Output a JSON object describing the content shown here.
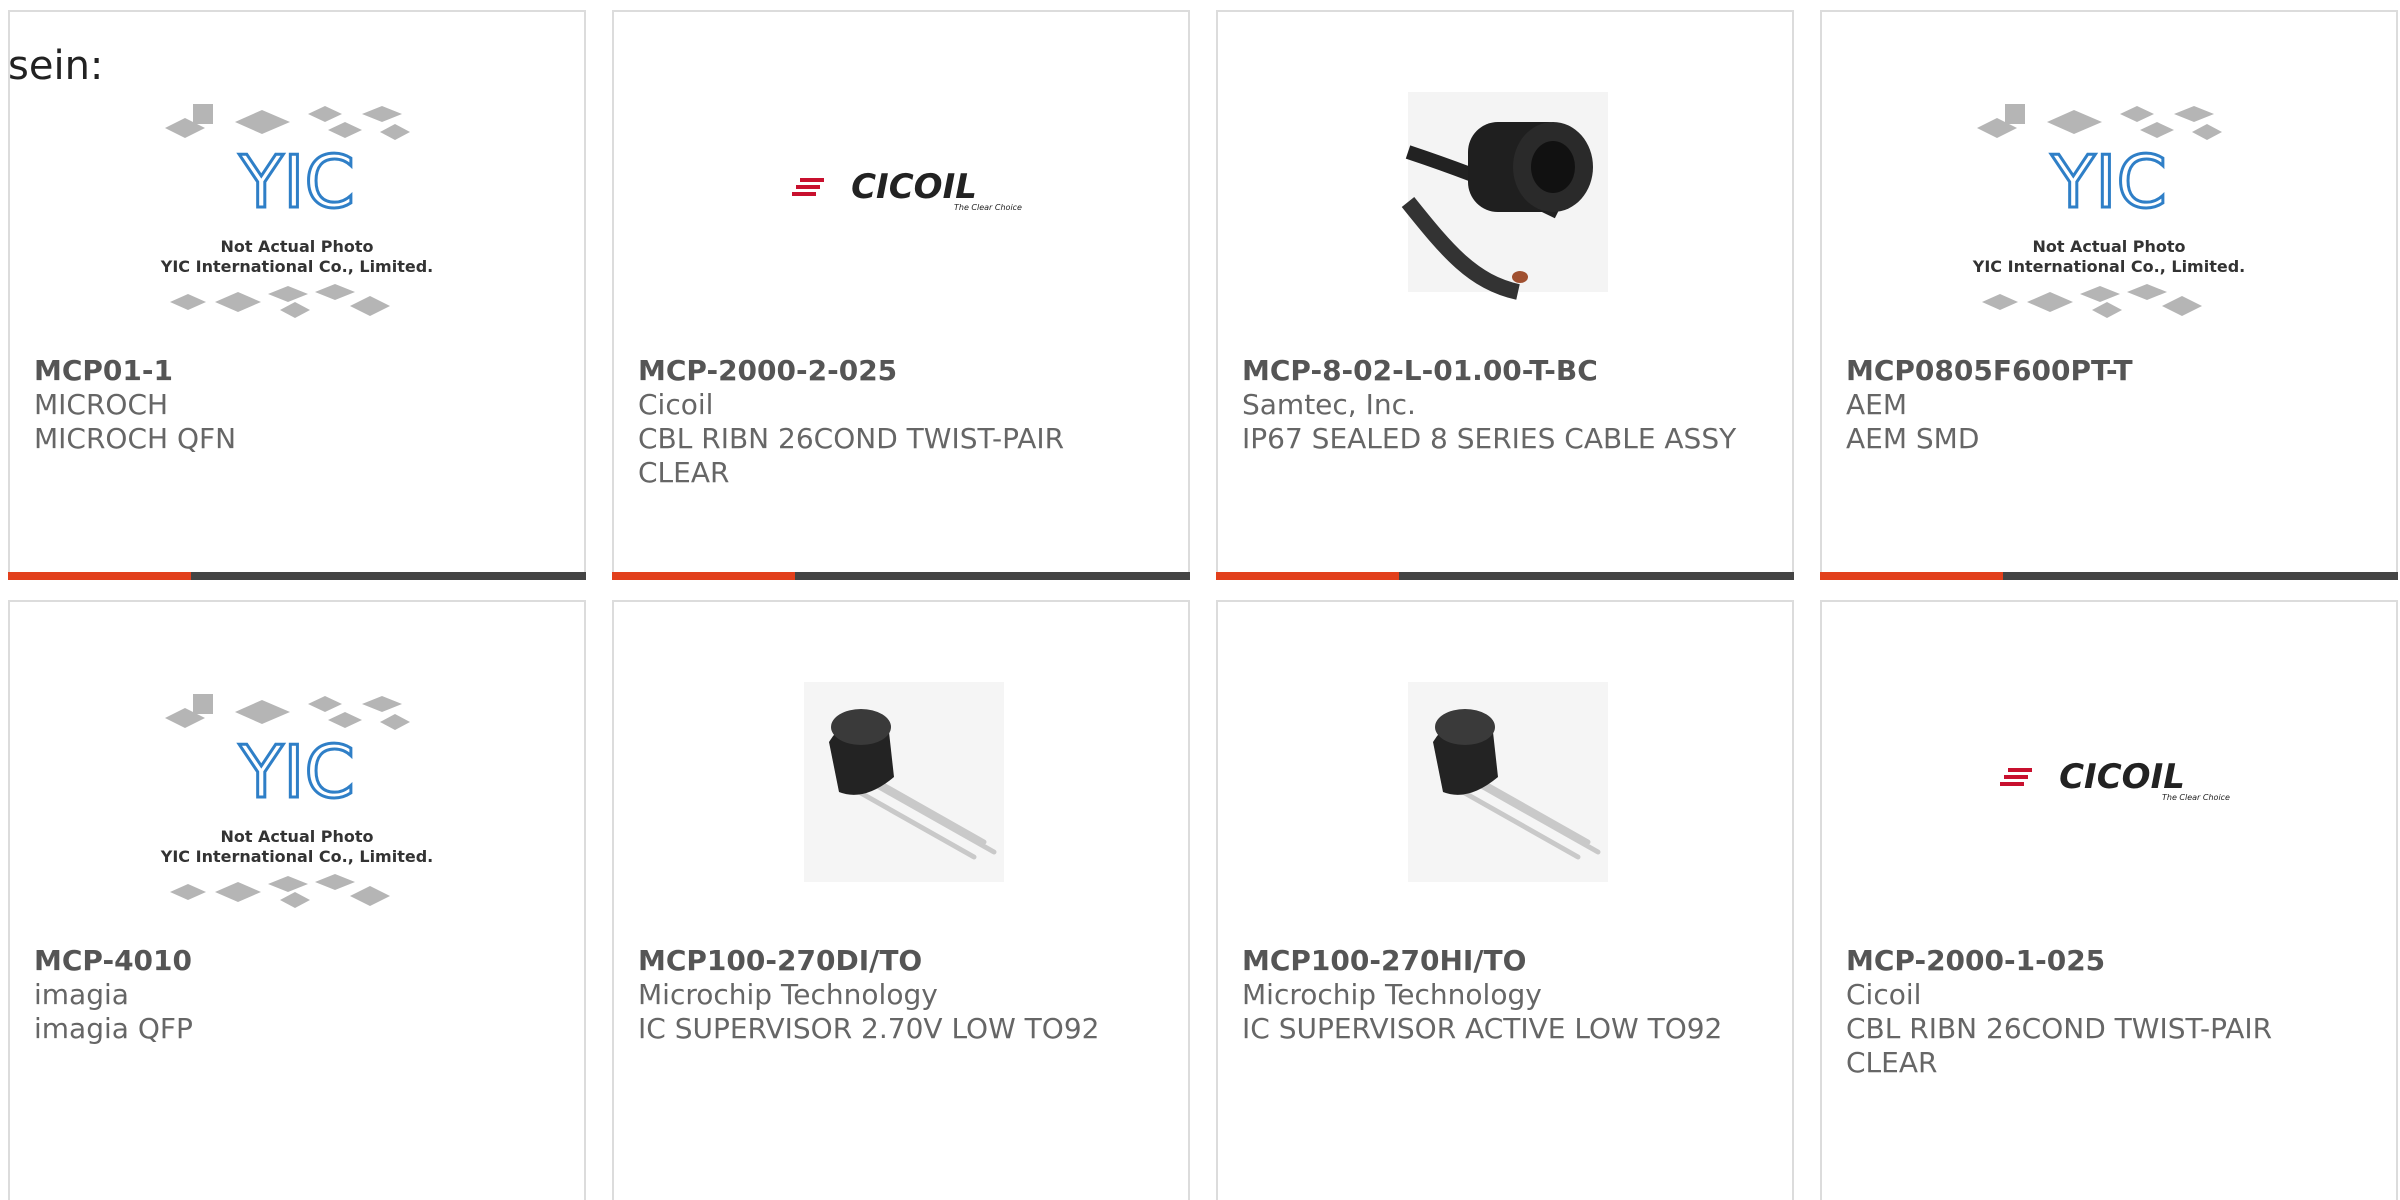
{
  "lead": "sein:",
  "products": [
    {
      "pn": "MCP01-1",
      "mfr": "MICROCH",
      "desc": "MICROCH QFN",
      "image": "yic-placeholder-icon",
      "yic_line1": "Not Actual Photo",
      "yic_line2": "YIC International Co., Limited."
    },
    {
      "pn": "MCP-2000-2-025",
      "mfr": "Cicoil",
      "desc": "CBL RIBN 26COND TWIST-PAIR CLEAR",
      "image": "cicoil-logo",
      "logo_text": "CICOIL",
      "logo_tag": "The Clear Choice"
    },
    {
      "pn": "MCP-8-02-L-01.00-T-BC",
      "mfr": "Samtec, Inc.",
      "desc": "IP67 SEALED 8 SERIES CABLE ASSY",
      "image": "cable-connector-photo"
    },
    {
      "pn": "MCP0805F600PT-T",
      "mfr": "AEM",
      "desc": "AEM SMD",
      "image": "yic-placeholder-icon",
      "yic_line1": "Not Actual Photo",
      "yic_line2": "YIC International Co., Limited."
    },
    {
      "pn": "MCP-4010",
      "mfr": "imagia",
      "desc": "imagia QFP",
      "image": "yic-placeholder-icon",
      "yic_line1": "Not Actual Photo",
      "yic_line2": "YIC International Co., Limited."
    },
    {
      "pn": "MCP100-270DI/TO",
      "mfr": "Microchip Technology",
      "desc": "IC SUPERVISOR 2.70V LOW TO92",
      "image": "to92-package-photo"
    },
    {
      "pn": "MCP100-270HI/TO",
      "mfr": "Microchip Technology",
      "desc": "IC SUPERVISOR ACTIVE LOW TO92",
      "image": "to92-package-photo"
    },
    {
      "pn": "MCP-2000-1-025",
      "mfr": "Cicoil",
      "desc": "CBL RIBN 26COND TWIST-PAIR CLEAR",
      "image": "cicoil-logo",
      "logo_text": "CICOIL",
      "logo_tag": "The Clear Choice"
    }
  ],
  "colors": {
    "accent": "#e2401c",
    "bar": "#444444",
    "border": "#dcdcdc",
    "yic_blue": "#2f7fc7"
  }
}
